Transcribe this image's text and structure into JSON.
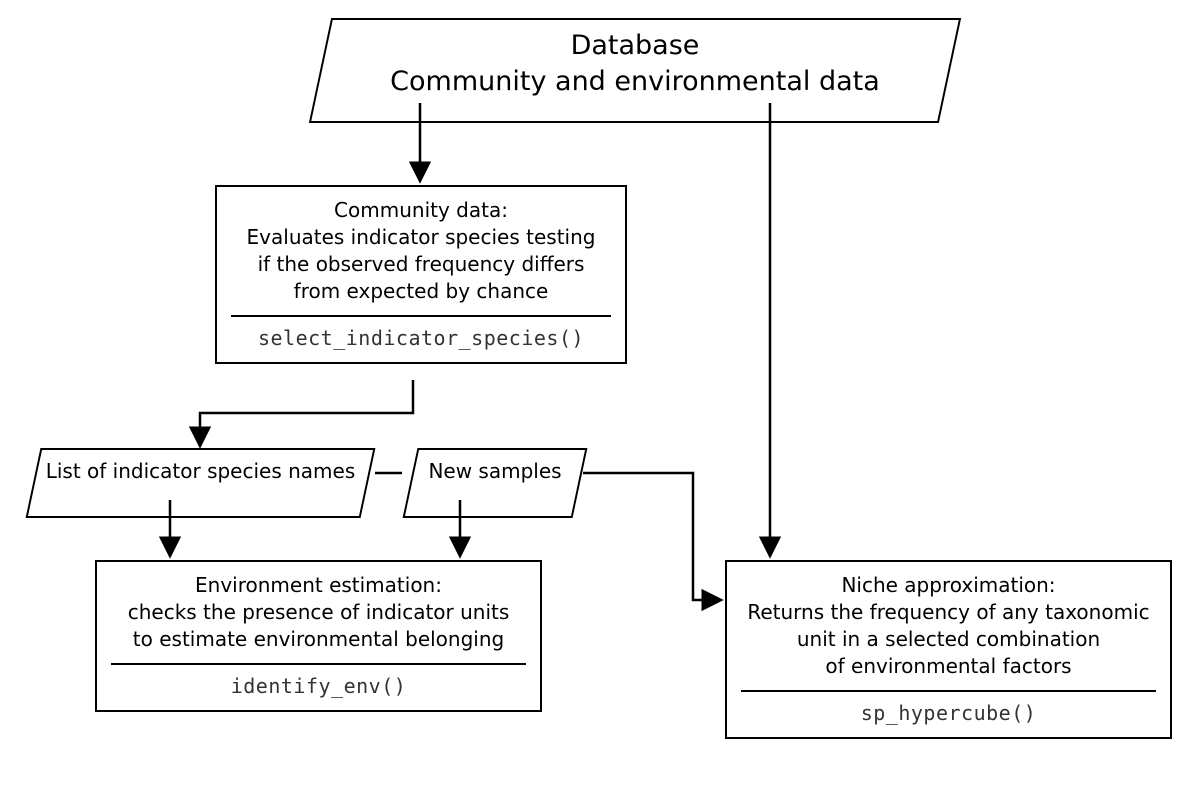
{
  "database": {
    "line1": "Database",
    "line2": "Community and environmental data"
  },
  "community": {
    "line1": "Community data:",
    "line2": "Evaluates indicator species testing",
    "line3": "if the observed frequency differs",
    "line4": "from expected by chance",
    "func": "select_indicator_species()"
  },
  "list_species": {
    "label": "List of indicator species names"
  },
  "new_samples": {
    "label": "New samples"
  },
  "env_est": {
    "line1": "Environment estimation:",
    "line2": "checks the presence of indicator units",
    "line3": "to estimate environmental belonging",
    "func": "identify_env()"
  },
  "niche": {
    "line1": "Niche approximation:",
    "line2": "Returns the frequency of any taxonomic",
    "line3": "unit in a selected combination",
    "line4": "of environmental factors",
    "func": "sp_hypercube()"
  }
}
